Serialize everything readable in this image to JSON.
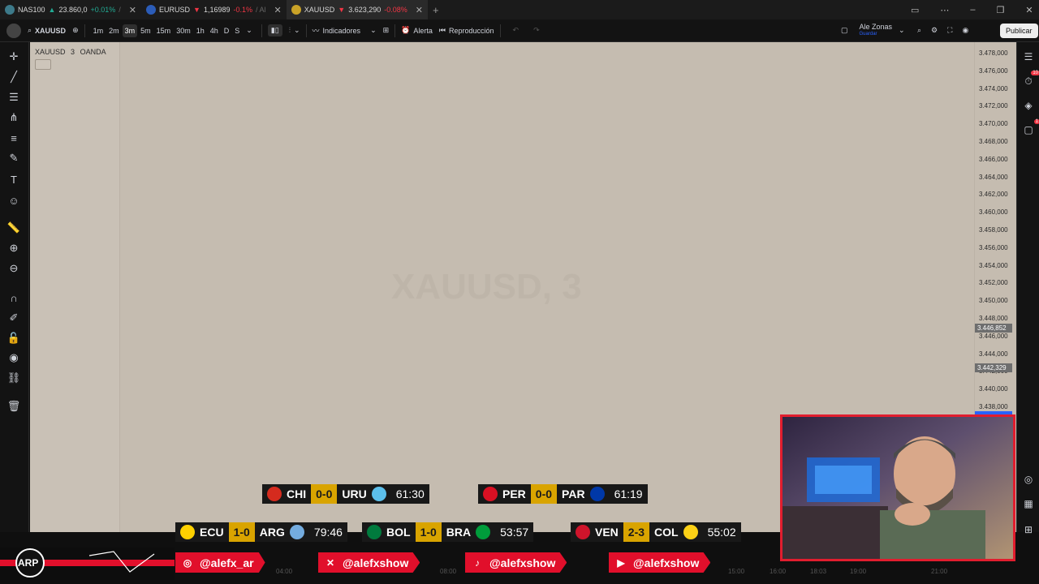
{
  "tabs": [
    {
      "symbol": "NAS100",
      "arrow": "▲",
      "price": "23.860,0",
      "change": "+0.01%",
      "direction": "up",
      "tail": "/"
    },
    {
      "symbol": "EURUSD",
      "arrow": "▼",
      "price": "1,16989",
      "change": "-0.1%",
      "direction": "down",
      "tail": "/ Al"
    },
    {
      "symbol": "XAUUSD",
      "arrow": "▼",
      "price": "3.623,290",
      "change": "-0.08%",
      "direction": "down",
      "tail": "",
      "active": true
    }
  ],
  "toolbar": {
    "symbol": "XAUUSD",
    "timeframes": [
      "1m",
      "2m",
      "3m",
      "5m",
      "15m",
      "30m",
      "1h",
      "4h",
      "D",
      "S"
    ],
    "selected_timeframe": "3m",
    "indicators_label": "Indicadores",
    "alert_label": "Alerta",
    "replay_label": "Reproducción",
    "layout_name": "Ale Zonas",
    "layout_sub": "Guardar",
    "publish_label": "Publicar"
  },
  "legend": {
    "symbol": "XAUUSD",
    "interval": "3",
    "broker": "OANDA"
  },
  "watermark": {
    "text": "XAUUSD, 3"
  },
  "price_axis": {
    "ticks": [
      "3.478,000",
      "3.476,000",
      "3.474,000",
      "3.472,000",
      "3.470,000",
      "3.468,000",
      "3.466,000",
      "3.464,000",
      "3.462,000",
      "3.460,000",
      "3.458,000",
      "3.456,000",
      "3.454,000",
      "3.452,000",
      "3.450,000",
      "3.448,000",
      "3.446,000",
      "3.444,000",
      "3.442,000",
      "3.440,000",
      "3.438,000"
    ],
    "marker_1": "3.446,852",
    "marker_2": "3.442,329"
  },
  "time_axis": {
    "labels": [
      "04:00",
      "08:00",
      "15:00",
      "16:00",
      "18:03",
      "19:00",
      "21:00"
    ]
  },
  "scores_top": [
    {
      "home": "CHI",
      "result": "0-0",
      "away": "URU",
      "time": "61:30",
      "home_color": "#d52b1e",
      "away_color": "#5cbfeb"
    },
    {
      "home": "PER",
      "result": "0-0",
      "away": "PAR",
      "time": "61:19",
      "home_color": "#d91023",
      "away_color": "#0038a8"
    }
  ],
  "scores_bottom": [
    {
      "home": "ECU",
      "result": "1-0",
      "away": "ARG",
      "time": "79:46",
      "home_color": "#ffd100",
      "away_color": "#74acdf"
    },
    {
      "home": "BOL",
      "result": "1-0",
      "away": "BRA",
      "time": "53:57",
      "home_color": "#007a3d",
      "away_color": "#009c3b"
    },
    {
      "home": "VEN",
      "result": "2-3",
      "away": "COL",
      "time": "55:02",
      "home_color": "#cf142b",
      "away_color": "#fcd116"
    }
  ],
  "social": [
    {
      "icon": "instagram-icon",
      "handle": "@alefx_ar"
    },
    {
      "icon": "x-icon",
      "handle": "@alefxshow"
    },
    {
      "icon": "tiktok-icon",
      "handle": "@alefxshow"
    },
    {
      "icon": "youtube-icon",
      "handle": "@alefxshow"
    }
  ],
  "logo_text": "ARP",
  "colors": {
    "up": "#22ab94",
    "down": "#f23645",
    "accent": "#e10f2b",
    "score_gold": "#d9a400",
    "chart_bg": "#c5bcb0"
  }
}
